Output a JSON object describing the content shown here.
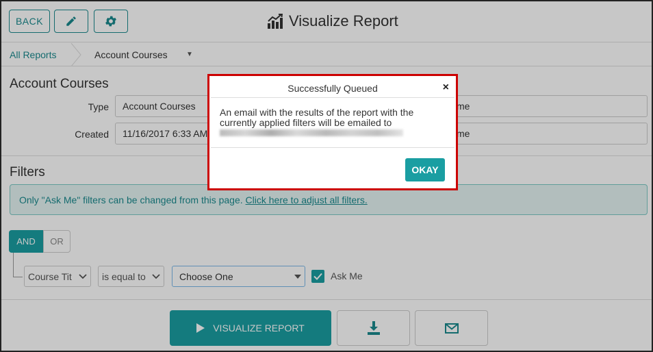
{
  "header": {
    "back_label": "BACK",
    "title": "Visualize Report",
    "edit_icon": "pencil-icon",
    "settings_icon": "gear-icon",
    "title_icon": "chart-icon"
  },
  "breadcrumb": {
    "root": "All Reports",
    "current": "Account Courses",
    "caret": "▼"
  },
  "report": {
    "heading": "Account Courses",
    "type_label": "Type",
    "type_value": "Account Courses",
    "created_label": "Created",
    "created_value": "11/16/2017 6:33 AM",
    "right_field_1_suffix": "me",
    "right_field_2_suffix": "me"
  },
  "filters": {
    "heading": "Filters",
    "info_text": "Only \"Ask Me\" filters can be changed from this page. ",
    "info_link": "Click here to adjust all filters.",
    "and_label": "AND",
    "or_label": "OR",
    "field_select": "Course Tit",
    "operator_select": "is equal to",
    "value_select": "Choose One",
    "ask_me_label": "Ask Me",
    "ask_me_checked": true
  },
  "actions": {
    "visualize_label": "VISUALIZE REPORT",
    "download_icon": "download-icon",
    "email_icon": "envelope-icon"
  },
  "modal": {
    "title": "Successfully Queued",
    "close": "×",
    "message": "An email with the results of the report with the currently applied filters will be emailed to",
    "okay_label": "OKAY"
  },
  "colors": {
    "accent": "#1a9ea2",
    "link": "#1a8a8e",
    "highlight_border": "#cc0000",
    "info_bg": "#e4f4f3"
  }
}
